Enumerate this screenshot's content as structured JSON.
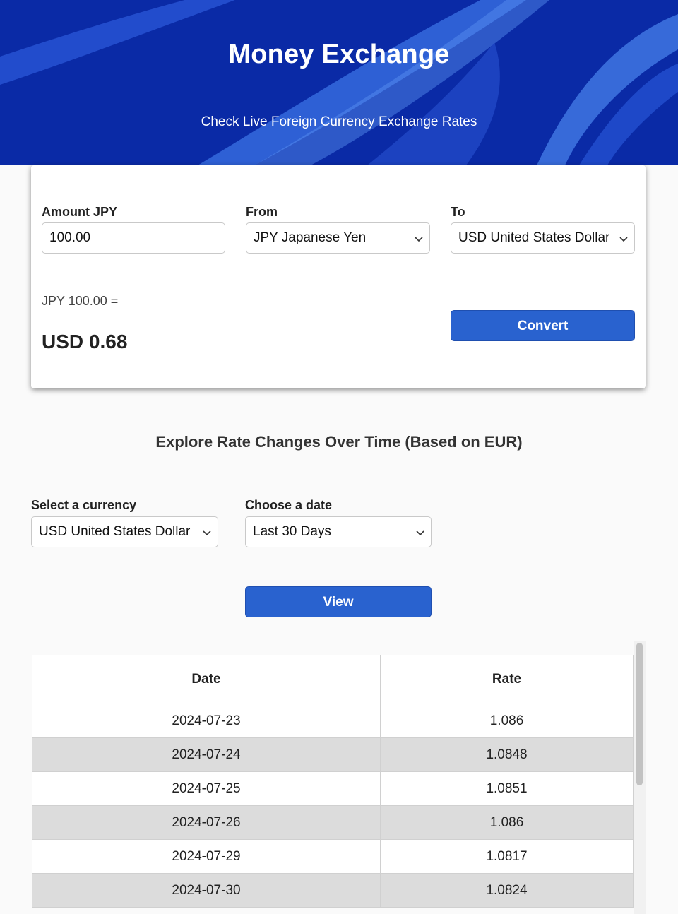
{
  "header": {
    "title": "Money Exchange",
    "subtitle": "Check Live Foreign Currency Exchange Rates"
  },
  "converter": {
    "amount_label": "Amount JPY",
    "amount_value": "100.00",
    "from_label": "From",
    "from_value": "JPY Japanese Yen",
    "to_label": "To",
    "to_value": "USD United States Dollar",
    "result_prefix": "JPY 100.00 =",
    "result_value": "USD 0.68",
    "convert_button": "Convert"
  },
  "history": {
    "title": "Explore Rate Changes Over Time (Based on EUR)",
    "currency_label": "Select a currency",
    "currency_value": "USD United States Dollar",
    "date_label": "Choose a date",
    "date_value": "Last 30 Days",
    "view_button": "View",
    "table": {
      "headers": [
        "Date",
        "Rate"
      ],
      "rows": [
        [
          "2024-07-23",
          "1.086"
        ],
        [
          "2024-07-24",
          "1.0848"
        ],
        [
          "2024-07-25",
          "1.0851"
        ],
        [
          "2024-07-26",
          "1.086"
        ],
        [
          "2024-07-29",
          "1.0817"
        ],
        [
          "2024-07-30",
          "1.0824"
        ]
      ]
    }
  },
  "colors": {
    "hero_bg": "#0a2aa6",
    "button": "#2962cf",
    "row_alt": "#dcdcdc"
  },
  "icons": [
    "chevron-down-icon"
  ]
}
